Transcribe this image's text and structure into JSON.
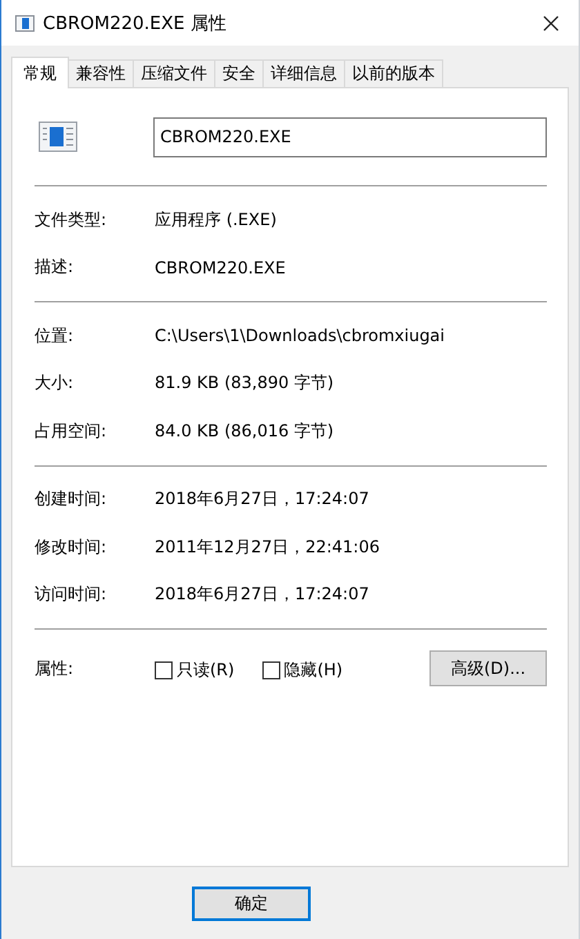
{
  "window": {
    "title": "CBROM220.EXE 属性"
  },
  "tabs": [
    {
      "label": "常规",
      "selected": true
    },
    {
      "label": "兼容性",
      "selected": false
    },
    {
      "label": "压缩文件",
      "selected": false
    },
    {
      "label": "安全",
      "selected": false
    },
    {
      "label": "详细信息",
      "selected": false
    },
    {
      "label": "以前的版本",
      "selected": false
    }
  ],
  "file_name": "CBROM220.EXE",
  "sections": [
    [
      {
        "label": "文件类型:",
        "value": "应用程序 (.EXE)"
      },
      {
        "label": "描述:",
        "value": "CBROM220.EXE"
      }
    ],
    [
      {
        "label": "位置:",
        "value": "C:\\Users\\1\\Downloads\\cbromxiugai"
      },
      {
        "label": "大小:",
        "value": "81.9 KB (83,890 字节)"
      },
      {
        "label": "占用空间:",
        "value": "84.0 KB (86,016 字节)"
      }
    ],
    [
      {
        "label": "创建时间:",
        "value": "2018年6月27日，17:24:07"
      },
      {
        "label": "修改时间:",
        "value": "2011年12月27日，22:41:06"
      },
      {
        "label": "访问时间:",
        "value": "2018年6月27日，17:24:07"
      }
    ]
  ],
  "attributes": {
    "label": "属性:",
    "checkboxes": [
      {
        "label": "只读(R)",
        "checked": false
      },
      {
        "label": "隐藏(H)",
        "checked": false
      }
    ],
    "advanced_button": "高级(D)..."
  },
  "buttons": [
    "确定"
  ]
}
